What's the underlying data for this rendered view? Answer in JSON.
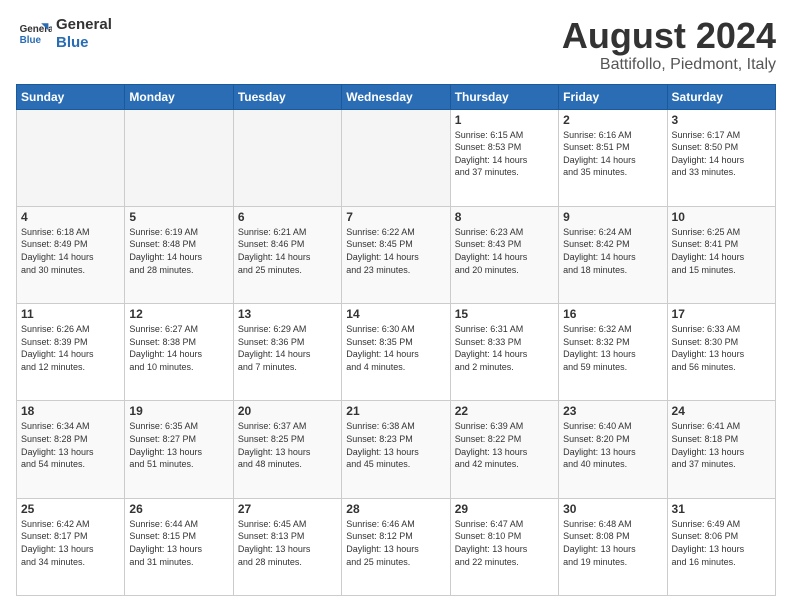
{
  "logo": {
    "line1": "General",
    "line2": "Blue"
  },
  "title": "August 2024",
  "location": "Battifollo, Piedmont, Italy",
  "weekdays": [
    "Sunday",
    "Monday",
    "Tuesday",
    "Wednesday",
    "Thursday",
    "Friday",
    "Saturday"
  ],
  "weeks": [
    [
      {
        "day": "",
        "info": ""
      },
      {
        "day": "",
        "info": ""
      },
      {
        "day": "",
        "info": ""
      },
      {
        "day": "",
        "info": ""
      },
      {
        "day": "1",
        "info": "Sunrise: 6:15 AM\nSunset: 8:53 PM\nDaylight: 14 hours\nand 37 minutes."
      },
      {
        "day": "2",
        "info": "Sunrise: 6:16 AM\nSunset: 8:51 PM\nDaylight: 14 hours\nand 35 minutes."
      },
      {
        "day": "3",
        "info": "Sunrise: 6:17 AM\nSunset: 8:50 PM\nDaylight: 14 hours\nand 33 minutes."
      }
    ],
    [
      {
        "day": "4",
        "info": "Sunrise: 6:18 AM\nSunset: 8:49 PM\nDaylight: 14 hours\nand 30 minutes."
      },
      {
        "day": "5",
        "info": "Sunrise: 6:19 AM\nSunset: 8:48 PM\nDaylight: 14 hours\nand 28 minutes."
      },
      {
        "day": "6",
        "info": "Sunrise: 6:21 AM\nSunset: 8:46 PM\nDaylight: 14 hours\nand 25 minutes."
      },
      {
        "day": "7",
        "info": "Sunrise: 6:22 AM\nSunset: 8:45 PM\nDaylight: 14 hours\nand 23 minutes."
      },
      {
        "day": "8",
        "info": "Sunrise: 6:23 AM\nSunset: 8:43 PM\nDaylight: 14 hours\nand 20 minutes."
      },
      {
        "day": "9",
        "info": "Sunrise: 6:24 AM\nSunset: 8:42 PM\nDaylight: 14 hours\nand 18 minutes."
      },
      {
        "day": "10",
        "info": "Sunrise: 6:25 AM\nSunset: 8:41 PM\nDaylight: 14 hours\nand 15 minutes."
      }
    ],
    [
      {
        "day": "11",
        "info": "Sunrise: 6:26 AM\nSunset: 8:39 PM\nDaylight: 14 hours\nand 12 minutes."
      },
      {
        "day": "12",
        "info": "Sunrise: 6:27 AM\nSunset: 8:38 PM\nDaylight: 14 hours\nand 10 minutes."
      },
      {
        "day": "13",
        "info": "Sunrise: 6:29 AM\nSunset: 8:36 PM\nDaylight: 14 hours\nand 7 minutes."
      },
      {
        "day": "14",
        "info": "Sunrise: 6:30 AM\nSunset: 8:35 PM\nDaylight: 14 hours\nand 4 minutes."
      },
      {
        "day": "15",
        "info": "Sunrise: 6:31 AM\nSunset: 8:33 PM\nDaylight: 14 hours\nand 2 minutes."
      },
      {
        "day": "16",
        "info": "Sunrise: 6:32 AM\nSunset: 8:32 PM\nDaylight: 13 hours\nand 59 minutes."
      },
      {
        "day": "17",
        "info": "Sunrise: 6:33 AM\nSunset: 8:30 PM\nDaylight: 13 hours\nand 56 minutes."
      }
    ],
    [
      {
        "day": "18",
        "info": "Sunrise: 6:34 AM\nSunset: 8:28 PM\nDaylight: 13 hours\nand 54 minutes."
      },
      {
        "day": "19",
        "info": "Sunrise: 6:35 AM\nSunset: 8:27 PM\nDaylight: 13 hours\nand 51 minutes."
      },
      {
        "day": "20",
        "info": "Sunrise: 6:37 AM\nSunset: 8:25 PM\nDaylight: 13 hours\nand 48 minutes."
      },
      {
        "day": "21",
        "info": "Sunrise: 6:38 AM\nSunset: 8:23 PM\nDaylight: 13 hours\nand 45 minutes."
      },
      {
        "day": "22",
        "info": "Sunrise: 6:39 AM\nSunset: 8:22 PM\nDaylight: 13 hours\nand 42 minutes."
      },
      {
        "day": "23",
        "info": "Sunrise: 6:40 AM\nSunset: 8:20 PM\nDaylight: 13 hours\nand 40 minutes."
      },
      {
        "day": "24",
        "info": "Sunrise: 6:41 AM\nSunset: 8:18 PM\nDaylight: 13 hours\nand 37 minutes."
      }
    ],
    [
      {
        "day": "25",
        "info": "Sunrise: 6:42 AM\nSunset: 8:17 PM\nDaylight: 13 hours\nand 34 minutes."
      },
      {
        "day": "26",
        "info": "Sunrise: 6:44 AM\nSunset: 8:15 PM\nDaylight: 13 hours\nand 31 minutes."
      },
      {
        "day": "27",
        "info": "Sunrise: 6:45 AM\nSunset: 8:13 PM\nDaylight: 13 hours\nand 28 minutes."
      },
      {
        "day": "28",
        "info": "Sunrise: 6:46 AM\nSunset: 8:12 PM\nDaylight: 13 hours\nand 25 minutes."
      },
      {
        "day": "29",
        "info": "Sunrise: 6:47 AM\nSunset: 8:10 PM\nDaylight: 13 hours\nand 22 minutes."
      },
      {
        "day": "30",
        "info": "Sunrise: 6:48 AM\nSunset: 8:08 PM\nDaylight: 13 hours\nand 19 minutes."
      },
      {
        "day": "31",
        "info": "Sunrise: 6:49 AM\nSunset: 8:06 PM\nDaylight: 13 hours\nand 16 minutes."
      }
    ]
  ]
}
